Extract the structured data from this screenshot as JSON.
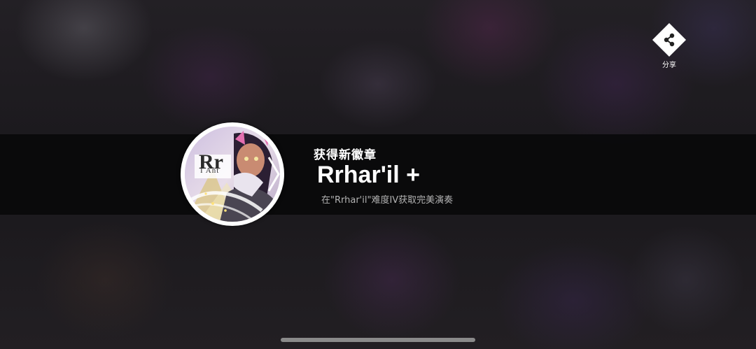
{
  "share": {
    "label": "分享",
    "icon": "share-icon"
  },
  "badge": {
    "subtitle": "获得新徽章",
    "name": "Rrhar'il +",
    "description": "在\"Rrhar'il\"难度IV获取完美演奏",
    "art_text": "Rr",
    "art_caption": "I Ant",
    "ring_color": "#ffffff"
  },
  "colors": {
    "banner": "#080809",
    "text_primary": "#ffffff",
    "text_secondary": "#b3b3b3"
  }
}
